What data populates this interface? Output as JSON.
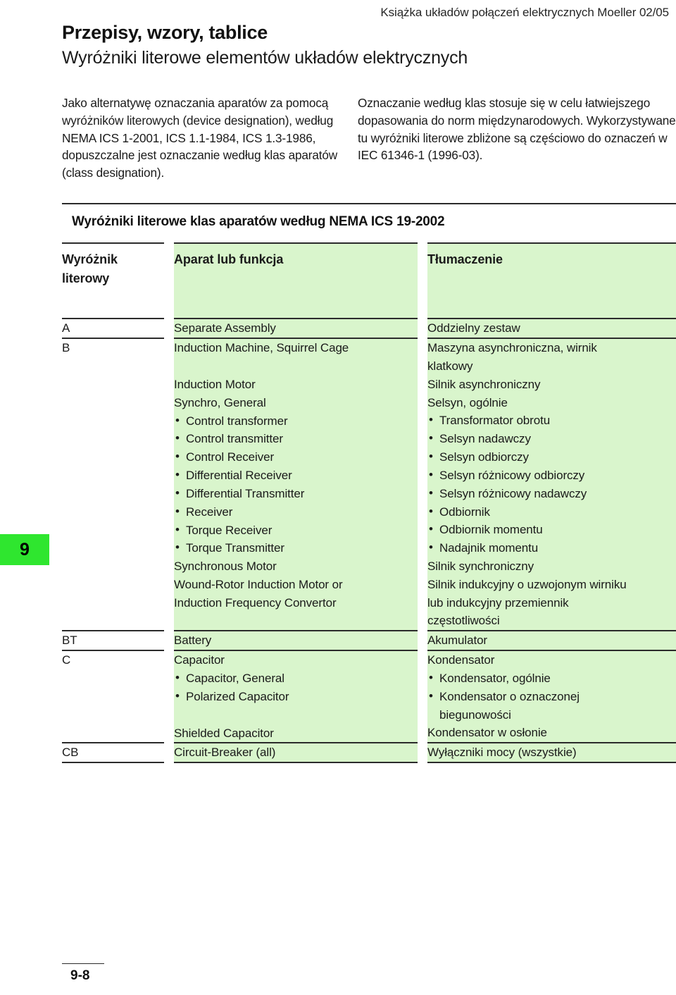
{
  "page": {
    "running_head": "Książka układów połączeń elektrycznych Moeller 02/05",
    "title_main": "Przepisy, wzory, tablice",
    "title_sub": "Wyróżniki literowe elementów układów elektrycznych",
    "index_tab": "9",
    "footer_page": "9-8",
    "tab_color": "#2FE62F",
    "column_color": "#D9F5CC"
  },
  "intro": {
    "left": "Jako alternatywę oznaczania aparatów za pomocą wyróżników literowych (device designation), według NEMA ICS 1-2001, ICS 1.1-1984, ICS 1.3-1986, dopuszczalne jest oznaczanie według klas aparatów (class designation).",
    "right": "Oznaczanie według klas stosuje się w celu łatwiejszego dopasowania do norm międzynarodowych. Wykorzystywane tu wyróżniki literowe zbliżone są częściowo do oznaczeń w IEC 61346-1 (1996-03)."
  },
  "table": {
    "section_title": "Wyróżniki literowe klas aparatów według NEMA ICS 19-2002",
    "headers": {
      "col1": "Wyróżnik\nliterowy",
      "col1_line1": "Wyróżnik",
      "col1_line2": "literowy",
      "col2": "Aparat lub funkcja",
      "col3": "Tłumaczenie"
    },
    "rows": [
      {
        "key": "A",
        "en_lines": [
          "Separate Assembly"
        ],
        "en_bullets_after": [],
        "pl_lines": [
          "Oddzielny zestaw"
        ],
        "pl_bullets_after": []
      },
      {
        "key": "B",
        "en_blocks": [
          {
            "type": "line",
            "text": "Induction Machine, Squirrel Cage"
          },
          {
            "type": "gap"
          },
          {
            "type": "line",
            "text": "Induction Motor"
          },
          {
            "type": "line",
            "text": "Synchro, General"
          },
          {
            "type": "bullets",
            "items": [
              "Control transformer",
              "Control transmitter",
              "Control Receiver",
              "Differential Receiver",
              "Differential Transmitter",
              "Receiver",
              "Torque Receiver",
              "Torque Transmitter"
            ]
          },
          {
            "type": "line",
            "text": "Synchronous Motor"
          },
          {
            "type": "line",
            "text": "Wound-Rotor Induction Motor or"
          },
          {
            "type": "line",
            "text": "Induction Frequency Convertor"
          }
        ],
        "pl_blocks": [
          {
            "type": "line",
            "text": "Maszyna asynchroniczna, wirnik"
          },
          {
            "type": "line",
            "text": "klatkowy"
          },
          {
            "type": "line",
            "text": "Silnik asynchroniczny"
          },
          {
            "type": "line",
            "text": "Selsyn, ogólnie"
          },
          {
            "type": "bullets",
            "items": [
              "Transformator obrotu",
              "Selsyn nadawczy",
              "Selsyn odbiorczy",
              "Selsyn różnicowy odbiorczy",
              "Selsyn różnicowy nadawczy",
              "Odbiornik",
              "Odbiornik momentu",
              "Nadajnik momentu"
            ]
          },
          {
            "type": "line",
            "text": "Silnik synchroniczny"
          },
          {
            "type": "line",
            "text": "Silnik indukcyjny o uzwojonym wirniku"
          },
          {
            "type": "line",
            "text": "lub indukcyjny przemiennik"
          },
          {
            "type": "line",
            "text": "częstotliwości"
          }
        ]
      },
      {
        "key": "BT",
        "en_blocks": [
          {
            "type": "line",
            "text": "Battery"
          }
        ],
        "pl_blocks": [
          {
            "type": "line",
            "text": "Akumulator"
          }
        ]
      },
      {
        "key": "C",
        "en_blocks": [
          {
            "type": "line",
            "text": "Capacitor"
          },
          {
            "type": "bullets",
            "items": [
              "Capacitor, General",
              "Polarized Capacitor"
            ]
          },
          {
            "type": "gap"
          },
          {
            "type": "line",
            "text": "Shielded Capacitor"
          }
        ],
        "pl_blocks": [
          {
            "type": "line",
            "text": "Kondensator"
          },
          {
            "type": "bullets",
            "items": [
              "Kondensator, ogólnie",
              "Kondensator o oznaczonej\nbiegunowości"
            ]
          },
          {
            "type": "line",
            "text": "Kondensator w osłonie"
          }
        ]
      },
      {
        "key": "CB",
        "en_blocks": [
          {
            "type": "line",
            "text": "Circuit-Breaker (all)"
          }
        ],
        "pl_blocks": [
          {
            "type": "line",
            "text": "Wyłączniki mocy (wszystkie)"
          }
        ]
      }
    ]
  }
}
